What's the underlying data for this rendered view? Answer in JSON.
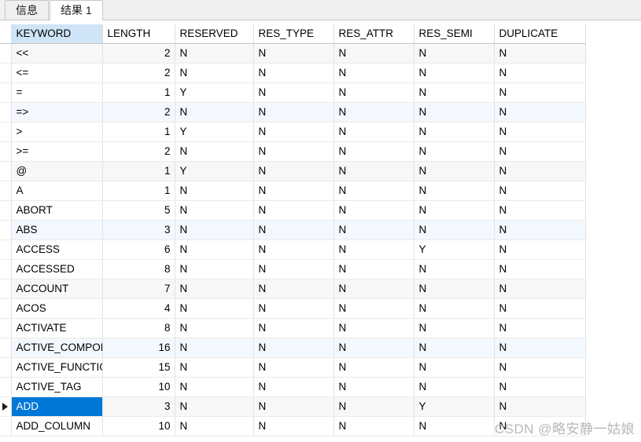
{
  "window": {
    "app_kind": "sql-result-grid"
  },
  "tabs": [
    {
      "label": "信息",
      "active": false,
      "name": "tab-info"
    },
    {
      "label": "结果 1",
      "active": true,
      "name": "tab-result-1"
    }
  ],
  "grid": {
    "selected_column": "KEYWORD",
    "selected_row_index": 18,
    "columns": [
      "KEYWORD",
      "LENGTH",
      "RESERVED",
      "RES_TYPE",
      "RES_ATTR",
      "RES_SEMI",
      "DUPLICATE"
    ],
    "rows": [
      {
        "KEYWORD": "<<",
        "LENGTH": "2",
        "RESERVED": "N",
        "RES_TYPE": "N",
        "RES_ATTR": "N",
        "RES_SEMI": "N",
        "DUPLICATE": "N"
      },
      {
        "KEYWORD": "<=",
        "LENGTH": "2",
        "RESERVED": "N",
        "RES_TYPE": "N",
        "RES_ATTR": "N",
        "RES_SEMI": "N",
        "DUPLICATE": "N"
      },
      {
        "KEYWORD": "=",
        "LENGTH": "1",
        "RESERVED": "Y",
        "RES_TYPE": "N",
        "RES_ATTR": "N",
        "RES_SEMI": "N",
        "DUPLICATE": "N"
      },
      {
        "KEYWORD": "=>",
        "LENGTH": "2",
        "RESERVED": "N",
        "RES_TYPE": "N",
        "RES_ATTR": "N",
        "RES_SEMI": "N",
        "DUPLICATE": "N"
      },
      {
        "KEYWORD": ">",
        "LENGTH": "1",
        "RESERVED": "Y",
        "RES_TYPE": "N",
        "RES_ATTR": "N",
        "RES_SEMI": "N",
        "DUPLICATE": "N"
      },
      {
        "KEYWORD": ">=",
        "LENGTH": "2",
        "RESERVED": "N",
        "RES_TYPE": "N",
        "RES_ATTR": "N",
        "RES_SEMI": "N",
        "DUPLICATE": "N"
      },
      {
        "KEYWORD": "@",
        "LENGTH": "1",
        "RESERVED": "Y",
        "RES_TYPE": "N",
        "RES_ATTR": "N",
        "RES_SEMI": "N",
        "DUPLICATE": "N"
      },
      {
        "KEYWORD": "A",
        "LENGTH": "1",
        "RESERVED": "N",
        "RES_TYPE": "N",
        "RES_ATTR": "N",
        "RES_SEMI": "N",
        "DUPLICATE": "N"
      },
      {
        "KEYWORD": "ABORT",
        "LENGTH": "5",
        "RESERVED": "N",
        "RES_TYPE": "N",
        "RES_ATTR": "N",
        "RES_SEMI": "N",
        "DUPLICATE": "N"
      },
      {
        "KEYWORD": "ABS",
        "LENGTH": "3",
        "RESERVED": "N",
        "RES_TYPE": "N",
        "RES_ATTR": "N",
        "RES_SEMI": "N",
        "DUPLICATE": "N"
      },
      {
        "KEYWORD": "ACCESS",
        "LENGTH": "6",
        "RESERVED": "N",
        "RES_TYPE": "N",
        "RES_ATTR": "N",
        "RES_SEMI": "Y",
        "DUPLICATE": "N"
      },
      {
        "KEYWORD": "ACCESSED",
        "LENGTH": "8",
        "RESERVED": "N",
        "RES_TYPE": "N",
        "RES_ATTR": "N",
        "RES_SEMI": "N",
        "DUPLICATE": "N"
      },
      {
        "KEYWORD": "ACCOUNT",
        "LENGTH": "7",
        "RESERVED": "N",
        "RES_TYPE": "N",
        "RES_ATTR": "N",
        "RES_SEMI": "N",
        "DUPLICATE": "N"
      },
      {
        "KEYWORD": "ACOS",
        "LENGTH": "4",
        "RESERVED": "N",
        "RES_TYPE": "N",
        "RES_ATTR": "N",
        "RES_SEMI": "N",
        "DUPLICATE": "N"
      },
      {
        "KEYWORD": "ACTIVATE",
        "LENGTH": "8",
        "RESERVED": "N",
        "RES_TYPE": "N",
        "RES_ATTR": "N",
        "RES_SEMI": "N",
        "DUPLICATE": "N"
      },
      {
        "KEYWORD": "ACTIVE_COMPONENT",
        "LENGTH": "16",
        "RESERVED": "N",
        "RES_TYPE": "N",
        "RES_ATTR": "N",
        "RES_SEMI": "N",
        "DUPLICATE": "N"
      },
      {
        "KEYWORD": "ACTIVE_FUNCTION",
        "LENGTH": "15",
        "RESERVED": "N",
        "RES_TYPE": "N",
        "RES_ATTR": "N",
        "RES_SEMI": "N",
        "DUPLICATE": "N"
      },
      {
        "KEYWORD": "ACTIVE_TAG",
        "LENGTH": "10",
        "RESERVED": "N",
        "RES_TYPE": "N",
        "RES_ATTR": "N",
        "RES_SEMI": "N",
        "DUPLICATE": "N"
      },
      {
        "KEYWORD": "ADD",
        "LENGTH": "3",
        "RESERVED": "N",
        "RES_TYPE": "N",
        "RES_ATTR": "N",
        "RES_SEMI": "Y",
        "DUPLICATE": "N"
      },
      {
        "KEYWORD": "ADD_COLUMN",
        "LENGTH": "10",
        "RESERVED": "N",
        "RES_TYPE": "N",
        "RES_ATTR": "N",
        "RES_SEMI": "N",
        "DUPLICATE": "N"
      }
    ]
  },
  "watermark": {
    "text": "CSDN @略安静一姑娘"
  },
  "colors": {
    "selection": "#0078d7",
    "column_header_selected": "#cfe4f7",
    "zebra_blue": "#f2f8fd",
    "zebra_gray": "#f7f7f7"
  }
}
